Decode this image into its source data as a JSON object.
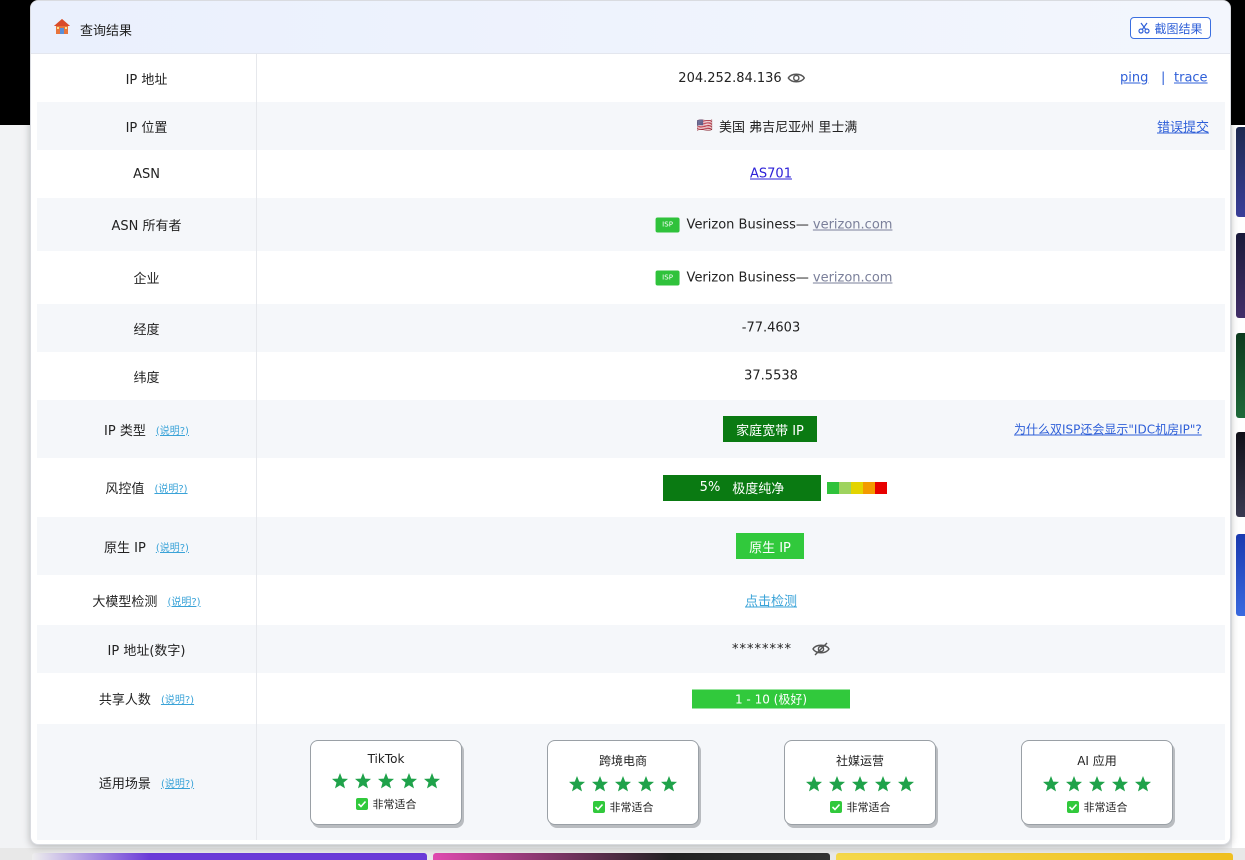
{
  "header": {
    "title": "查询结果",
    "screenshot_button": "截图结果"
  },
  "rows": {
    "ip": {
      "label": "IP 地址",
      "value": "204.252.84.136",
      "ping": "ping",
      "separator": "|",
      "trace": "trace"
    },
    "location": {
      "label": "IP 位置",
      "flag": "🇺🇸",
      "value": "美国 弗吉尼亚州 里士满",
      "report": "错误提交"
    },
    "asn": {
      "label": "ASN",
      "value": "AS701"
    },
    "asn_owner": {
      "label": "ASN 所有者",
      "badge": "ISP",
      "name": "Verizon Business—",
      "domain": "verizon.com"
    },
    "company": {
      "label": "企业",
      "badge": "ISP",
      "name": "Verizon Business—",
      "domain": "verizon.com"
    },
    "longitude": {
      "label": "经度",
      "value": "-77.4603"
    },
    "latitude": {
      "label": "纬度",
      "value": "37.5538"
    },
    "ip_type": {
      "label": "IP 类型",
      "help": "(说明?)",
      "value": "家庭宽带 IP",
      "why_link": "为什么双ISP还会显示\"IDC机房IP\"?"
    },
    "risk": {
      "label": "风控值",
      "help": "(说明?)",
      "percent": "5%",
      "level": "极度纯净",
      "scale_colors": [
        "#2fc23b",
        "#9ed35f",
        "#e3d400",
        "#f39a00",
        "#e80000"
      ]
    },
    "native": {
      "label": "原生 IP",
      "help": "(说明?)",
      "value": "原生 IP"
    },
    "llm": {
      "label": "大模型检测",
      "help": "(说明?)",
      "value": "点击检测"
    },
    "ip_numeric": {
      "label": "IP 地址(数字)",
      "value": "********"
    },
    "shared": {
      "label": "共享人数",
      "help": "(说明?)",
      "value": "1 - 10 (极好)"
    },
    "scenes": {
      "label": "适用场景",
      "help": "(说明?)",
      "items": [
        {
          "name": "TikTok",
          "fit": "非常适合",
          "stars": 5
        },
        {
          "name": "跨境电商",
          "fit": "非常适合",
          "stars": 5
        },
        {
          "name": "社媒运营",
          "fit": "非常适合",
          "stars": 5
        },
        {
          "name": "AI 应用",
          "fit": "非常适合",
          "stars": 5
        }
      ]
    }
  },
  "colors": {
    "accent_blue": "#2e5fd8",
    "badge_dark_green": "#0a7a12",
    "badge_light_green": "#31c93c",
    "star_green": "#1fa24a"
  }
}
